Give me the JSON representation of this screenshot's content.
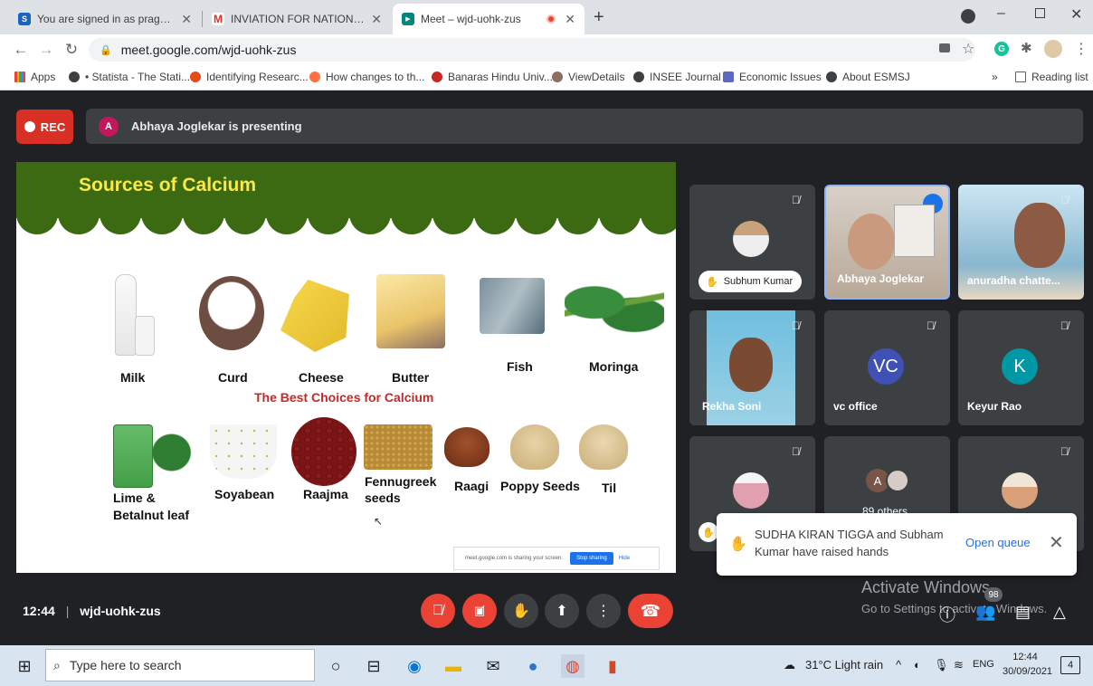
{
  "browser": {
    "tabs": [
      {
        "title": "You are signed in as pragatik_eco",
        "favicon": "S",
        "favicon_color": "#1565c0"
      },
      {
        "title": "INVIATION FOR NATIONAL WEB",
        "favicon": "M",
        "favicon_color": "#d93025"
      },
      {
        "title": "Meet – wjd-uohk-zus",
        "favicon": "▶",
        "favicon_color": "#00897b",
        "recording": true
      }
    ],
    "url": "meet.google.com/wjd-uohk-zus",
    "bookmarks": [
      {
        "label": "Apps"
      },
      {
        "label": "• Statista - The Stati..."
      },
      {
        "label": "Identifying Researc..."
      },
      {
        "label": "How changes to th..."
      },
      {
        "label": "Banaras Hindu Univ..."
      },
      {
        "label": "ViewDetails"
      },
      {
        "label": "INSEE Journal"
      },
      {
        "label": "Economic Issues"
      },
      {
        "label": "About ESMSJ"
      }
    ],
    "reading_list": "Reading list",
    "more_bookmarks": "»"
  },
  "meet": {
    "rec_label": "REC",
    "presenter_initial": "A",
    "presenting_text": "Abhaya Joglekar is presenting",
    "slide": {
      "title": "Sources of Calcium",
      "subtitle": "The Best Choices  for Calcium",
      "row1": [
        "Milk",
        "Curd",
        "Cheese",
        "Butter",
        "Fish",
        "Moringa"
      ],
      "row2": [
        "Lime &\nBetalnut leaf",
        "Soyabean",
        "Raajma",
        "Fennugreek\nseeds",
        "Raagi",
        "Poppy Seeds",
        "Til"
      ],
      "share_text": "meet.google.com is sharing your screen.",
      "stop_sharing": "Stop sharing",
      "hide": "Hide"
    },
    "participants": [
      {
        "name": "Subhum Kumar"
      },
      {
        "name": "Abhaya Joglekar"
      },
      {
        "name": "anuradha chatte..."
      },
      {
        "name": "Rekha Soni"
      },
      {
        "name": "vc office",
        "initials": "VC",
        "color": "#3f51b5"
      },
      {
        "name": "Keyur Rao",
        "initials": "K",
        "color": "#0097a7"
      },
      {
        "name": "89 others",
        "initials": "A"
      }
    ],
    "toast": {
      "message": "SUDHA KIRAN TIGGA and Subham Kumar have raised hands",
      "action": "Open queue"
    },
    "time": "12:44",
    "meeting_code": "wjd-uohk-zus",
    "participant_count": "98",
    "activate_title": "Activate Windows",
    "activate_sub": "Go to Settings to activate Windows."
  },
  "taskbar": {
    "search_placeholder": "Type here to search",
    "weather": "31°C  Light rain",
    "lang": "ENG",
    "clock_time": "12:44",
    "clock_date": "30/09/2021",
    "notifications": "4"
  }
}
